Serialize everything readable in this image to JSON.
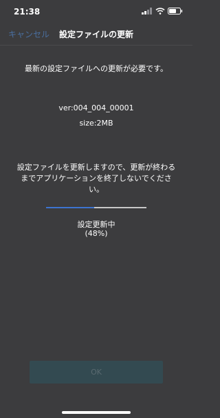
{
  "status_bar": {
    "time": "21:38",
    "icons": [
      "signal-icon",
      "wifi-icon",
      "battery-icon"
    ]
  },
  "nav": {
    "cancel_label": "キャンセル",
    "title": "設定ファイルの更新"
  },
  "content": {
    "update_required": "最新の設定ファイルへの更新が必要です。",
    "version": "ver:004_004_00001",
    "size": "size:2MB",
    "warning": "設定ファイルを更新しますので、更新が終わるまでアプリケーションを終了しないでください。"
  },
  "progress": {
    "percent": 48,
    "status_label": "設定更新中",
    "percent_label": "(48%)"
  },
  "ok_button": {
    "label": "OK",
    "enabled": false
  },
  "colors": {
    "background": "#3c3c3e",
    "accent": "#3d74d0",
    "cancel_link": "#4a6fa0",
    "ok_button_disabled": "#334a51"
  }
}
